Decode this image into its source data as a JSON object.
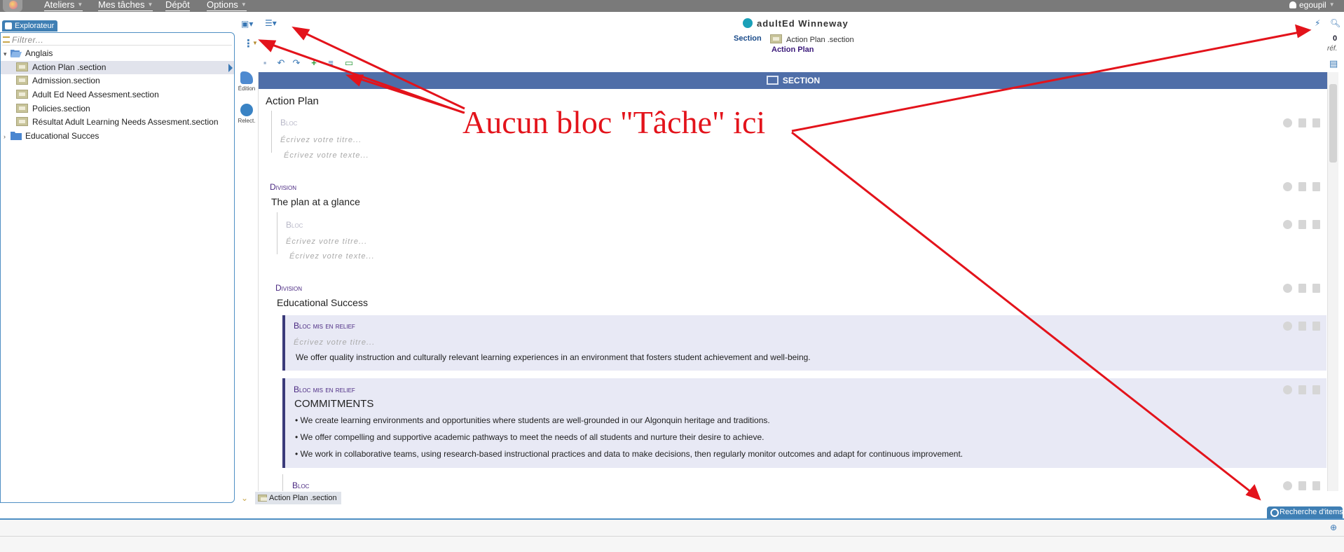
{
  "menubar": {
    "items": [
      {
        "label": "Ateliers"
      },
      {
        "label": "Mes tâches"
      },
      {
        "label": "Dépôt"
      },
      {
        "label": "Options"
      }
    ],
    "user": "egoupil"
  },
  "explorer": {
    "tab_label": "Explorateur",
    "filter_placeholder": "Filtrer...",
    "tree": [
      {
        "label": "Anglais",
        "type": "folder-open"
      },
      {
        "label": "Action Plan .section",
        "type": "section",
        "selected": true
      },
      {
        "label": "Admission.section",
        "type": "section"
      },
      {
        "label": "Adult Ed Need Assesment.section",
        "type": "section"
      },
      {
        "label": "Policies.section",
        "type": "section"
      },
      {
        "label": "Résultat Adult Learning Needs Assesment.section",
        "type": "section"
      },
      {
        "label": "Educational Succes",
        "type": "folder"
      }
    ]
  },
  "header": {
    "title": "adultEd Winneway",
    "crumb_type": "Section",
    "crumb_file": "Action Plan .section",
    "crumb_title": "Action Plan",
    "ref_count": "0",
    "ref_label": "réf."
  },
  "side_tools": {
    "edit_label": "Édition",
    "review_label": "Relect."
  },
  "editor": {
    "banner": "SECTION",
    "section_title": "Action Plan",
    "block_label": "Bloc",
    "title_placeholder": "Écrivez votre titre...",
    "text_placeholder": "Écrivez votre texte...",
    "division_label": "Division",
    "division1_title": "The plan at a glance",
    "division2_title": "Educational Success",
    "relief_label": "Bloc mis en relief",
    "relief1_text": "We offer quality instruction and culturally relevant learning experiences in an environment that fosters student achievement and well-being.",
    "relief2_title": "COMMITMENTS",
    "bullets": [
      "We create learning environments and opportunities where students are well-grounded in our Algonquin heritage and traditions.",
      "We offer compelling and supportive academic pathways to meet the needs of all students and nurture their desire to achieve.",
      "We work in collaborative teams, using research-based instructional practices and data to make decisions, then regularly monitor outcomes and adapt for continuous improvement."
    ]
  },
  "footer": {
    "doc_tab": "Action Plan .section",
    "search_tab": "Recherche d'items"
  },
  "annotation": {
    "text": "Aucun bloc \"Tâche\" ici",
    "color": "#e3131b"
  },
  "colors": {
    "menubar": "#7a7a7a",
    "accent": "#3f7fb4",
    "banner": "#4f6ea8",
    "relief_bg": "#e8e9f5"
  }
}
